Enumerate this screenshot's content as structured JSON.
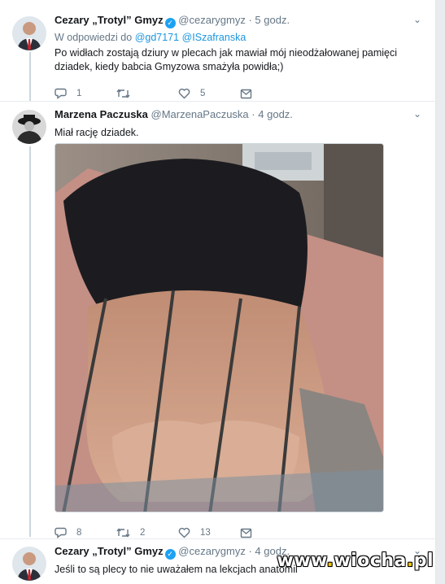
{
  "tweet1": {
    "name": "Cezary „Trotyl” Gmyz",
    "handle": "@cezarygmyz",
    "separator": "·",
    "time": "5 godz.",
    "reply_prefix": "W odpowiedzi do",
    "mentions": [
      "@gd7171",
      "@ISzafranska"
    ],
    "text": "Po widłach zostają dziury w plecach jak mawiał mój nieodżałowanej pamięci dziadek, kiedy babcia Gmyzowa smażyła powidła;)",
    "reply_count": "1",
    "retweet_count": "",
    "like_count": "5"
  },
  "tweet2": {
    "name": "Marzena Paczuska",
    "handle": "@MarzenaPaczuska",
    "separator": "·",
    "time": "4 godz.",
    "text": "Miał rację dziadek.",
    "reply_count": "8",
    "retweet_count": "2",
    "like_count": "13"
  },
  "tweet3": {
    "name": "Cezary „Trotyl” Gmyz",
    "handle": "@cezarygmyz",
    "separator": "·",
    "time": "4 godz.",
    "text": "Jeśli to są plecy to nie uważałem na lekcjach anatomii"
  },
  "watermark": {
    "text_a": "www",
    "dot1": ".",
    "text_b": "wiocha",
    "dot2": ".",
    "text_c": "pl"
  },
  "icons": {
    "verified": "verified-check-icon",
    "reply": "reply-icon",
    "retweet": "retweet-icon",
    "like": "heart-icon",
    "message": "envelope-icon",
    "menu": "chevron-down-icon"
  },
  "colors": {
    "accent": "#1da1f2",
    "link": "#1b95e0",
    "muted": "#657786"
  }
}
